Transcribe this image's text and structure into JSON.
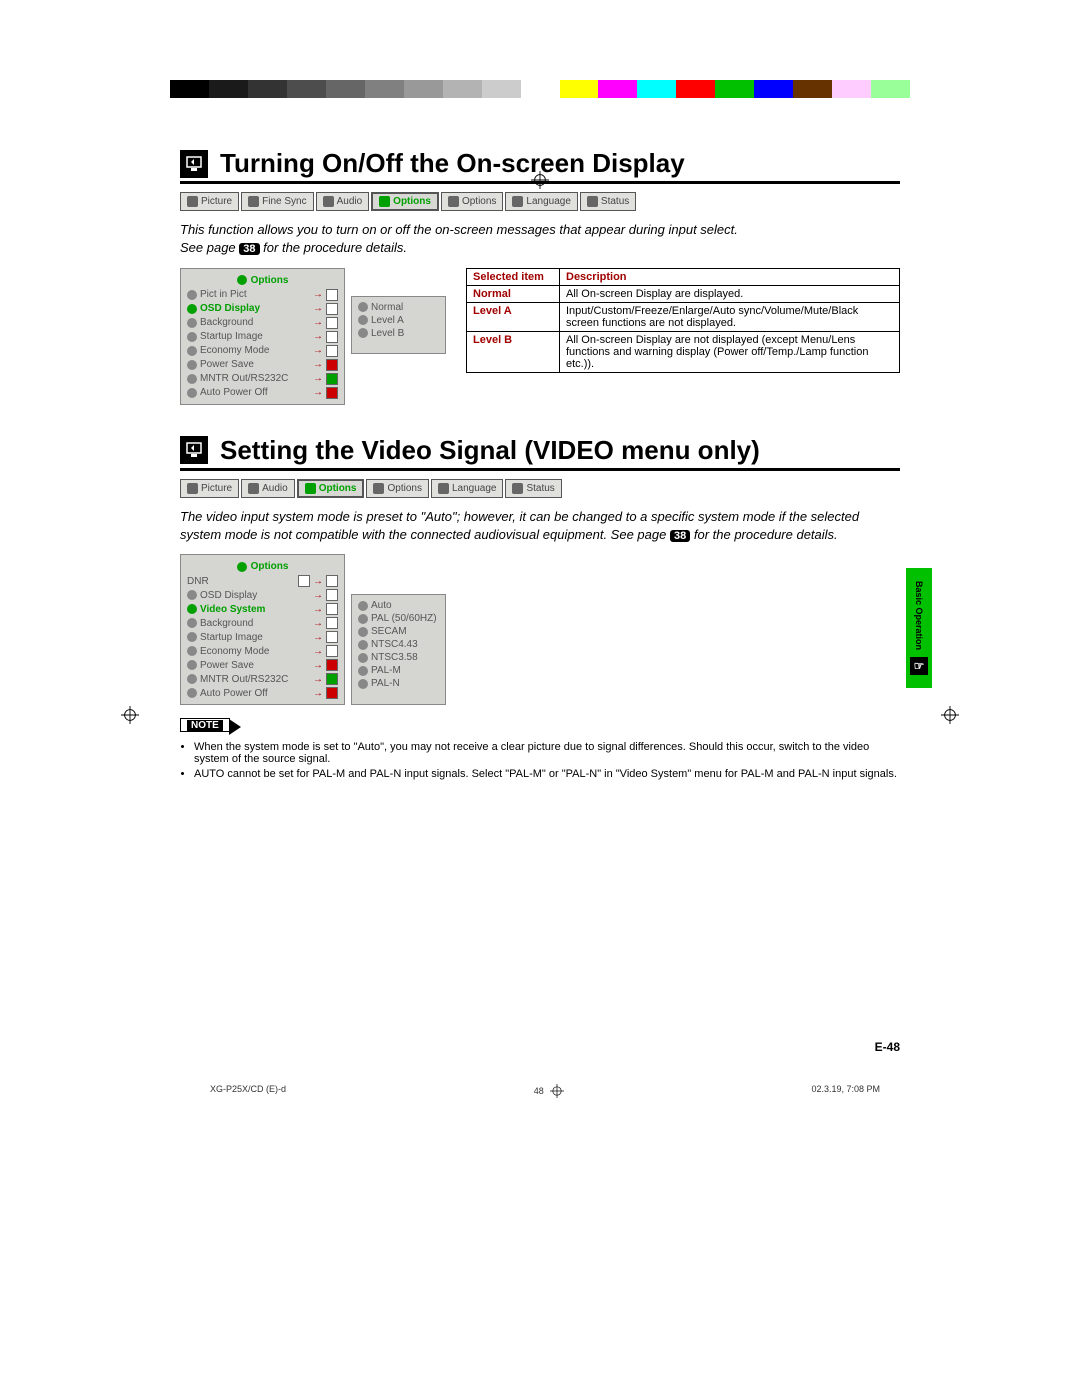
{
  "colorBar": [
    "#000",
    "#1a1a1a",
    "#333",
    "#4d4d4d",
    "#666",
    "#808080",
    "#999",
    "#b3b3b3",
    "#ccc",
    "#fff",
    "#ffff00",
    "#ff00ff",
    "#00ffff",
    "#ff0000",
    "#00c000",
    "#0000ff",
    "#663300",
    "#ffccff",
    "#99ff99"
  ],
  "section1": {
    "title": "Turning On/Off the On-screen Display",
    "tabs": [
      "Picture",
      "Fine Sync",
      "Audio",
      "Options",
      "Options",
      "Language",
      "Status"
    ],
    "selectedTab": 3,
    "descA": "This function allows you to turn on or off the on-screen messages that appear during input select.",
    "descB_a": "See page",
    "pageRef": "38",
    "descB_b": "for the procedure details.",
    "panelTitle": "Options",
    "panelItems": [
      "Pict in Pict",
      "OSD Display",
      "Background",
      "Startup Image",
      "Economy Mode",
      "Power Save",
      "MNTR Out/RS232C",
      "Auto Power Off"
    ],
    "panelSelected": 1,
    "subItems": [
      "Normal",
      "Level A",
      "Level B"
    ],
    "table": {
      "head": [
        "Selected item",
        "Description"
      ],
      "rows": [
        [
          "Normal",
          "All On-screen Display are displayed."
        ],
        [
          "Level A",
          "Input/Custom/Freeze/Enlarge/Auto sync/Volume/Mute/Black screen functions are not displayed."
        ],
        [
          "Level B",
          "All On-screen Display are not displayed (except Menu/Lens functions and warning display (Power off/Temp./Lamp function etc.))."
        ]
      ]
    }
  },
  "section2": {
    "title": "Setting the Video Signal (VIDEO menu only)",
    "tabs": [
      "Picture",
      "Audio",
      "Options",
      "Options",
      "Language",
      "Status"
    ],
    "selectedTab": 2,
    "descA": "The video input system mode is preset to \"Auto\"; however, it can be changed to a specific system mode if the selected system mode is not compatible with the connected audiovisual equipment.  See page",
    "pageRef": "38",
    "descB": "for the procedure details.",
    "panelTitle": "Options",
    "panelTop": "DNR",
    "panelItems": [
      "OSD Display",
      "Video System",
      "Background",
      "Startup Image",
      "Economy Mode",
      "Power Save",
      "MNTR Out/RS232C",
      "Auto Power Off"
    ],
    "panelSelected": 1,
    "subItems": [
      "Auto",
      "PAL (50/60HZ)",
      "SECAM",
      "NTSC4.43",
      "NTSC3.58",
      "PAL-M",
      "PAL-N"
    ]
  },
  "noteLabel": "NOTE",
  "notes": [
    "When the system mode is set to \"Auto\", you may not receive a clear picture due to signal differences. Should this occur, switch to the video system of the source signal.",
    "AUTO cannot be set for PAL-M and PAL-N input signals. Select \"PAL-M\" or \"PAL-N\" in \"Video System\" menu for PAL-M and PAL-N input signals."
  ],
  "sideTab": "Basic Operation",
  "pageNumber": "E-48",
  "footer": {
    "left": "XG-P25X/CD (E)-d",
    "center": "48",
    "right": "02.3.19, 7:08 PM"
  }
}
